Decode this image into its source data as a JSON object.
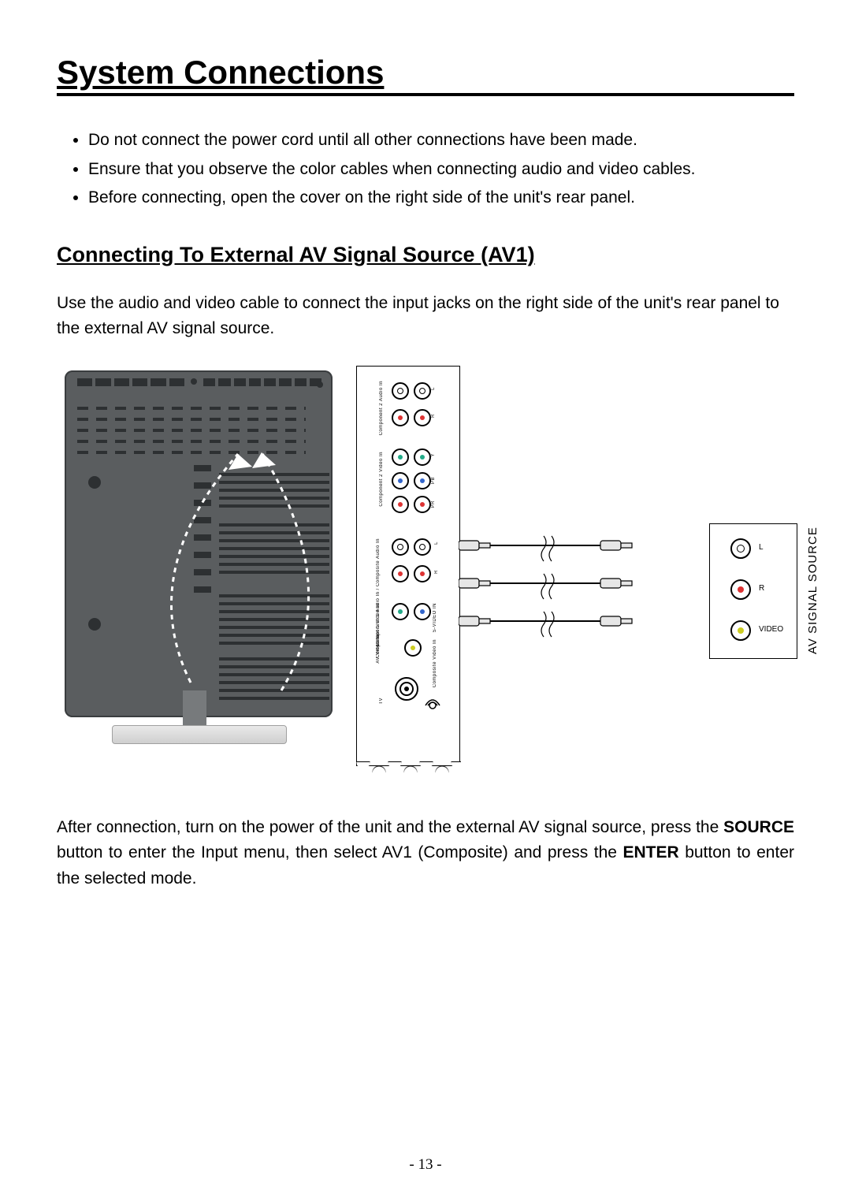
{
  "title": "System Connections",
  "instructions": [
    "Do not connect the power cord until all other connections have been made.",
    "Ensure that you observe the color cables when connecting audio and video cables.",
    "Before connecting, open the cover on the right side of the unit's rear panel."
  ],
  "subheading": "Connecting To External AV Signal Source (AV1)",
  "intro_paragraph": "Use the audio and video cable to connect the input jacks on the right side of the unit's rear panel to the external AV signal source.",
  "outro": {
    "part1": "After connection, turn on the power of the unit and the external AV signal source, press the ",
    "bold1": "SOURCE",
    "part2": " button to enter the Input menu, then select AV1 (Composite) and press the ",
    "bold2": "ENTER",
    "part3": " button to enter the selected mode."
  },
  "diagram": {
    "panel_labels": {
      "comp2_audio": "Component 2 Audio In",
      "comp2_video": "Component 2 Video In",
      "comp1_audio": "Component 1 Audio In / Composite Audio In",
      "svideo": "S-VIDEO IN",
      "comp1_video": "Component 1 Video In",
      "av_video": "AV Video In",
      "comp_video_in": "Composite Video In",
      "tv": "TV",
      "audio_l": "L",
      "audio_r": "R",
      "y": "Y",
      "pb": "PB",
      "pr": "PR"
    },
    "av_box": {
      "title": "AV SIGNAL SOURCE",
      "l": "L",
      "r": "R",
      "video": "VIDEO"
    }
  },
  "page_number": "- 13 -"
}
